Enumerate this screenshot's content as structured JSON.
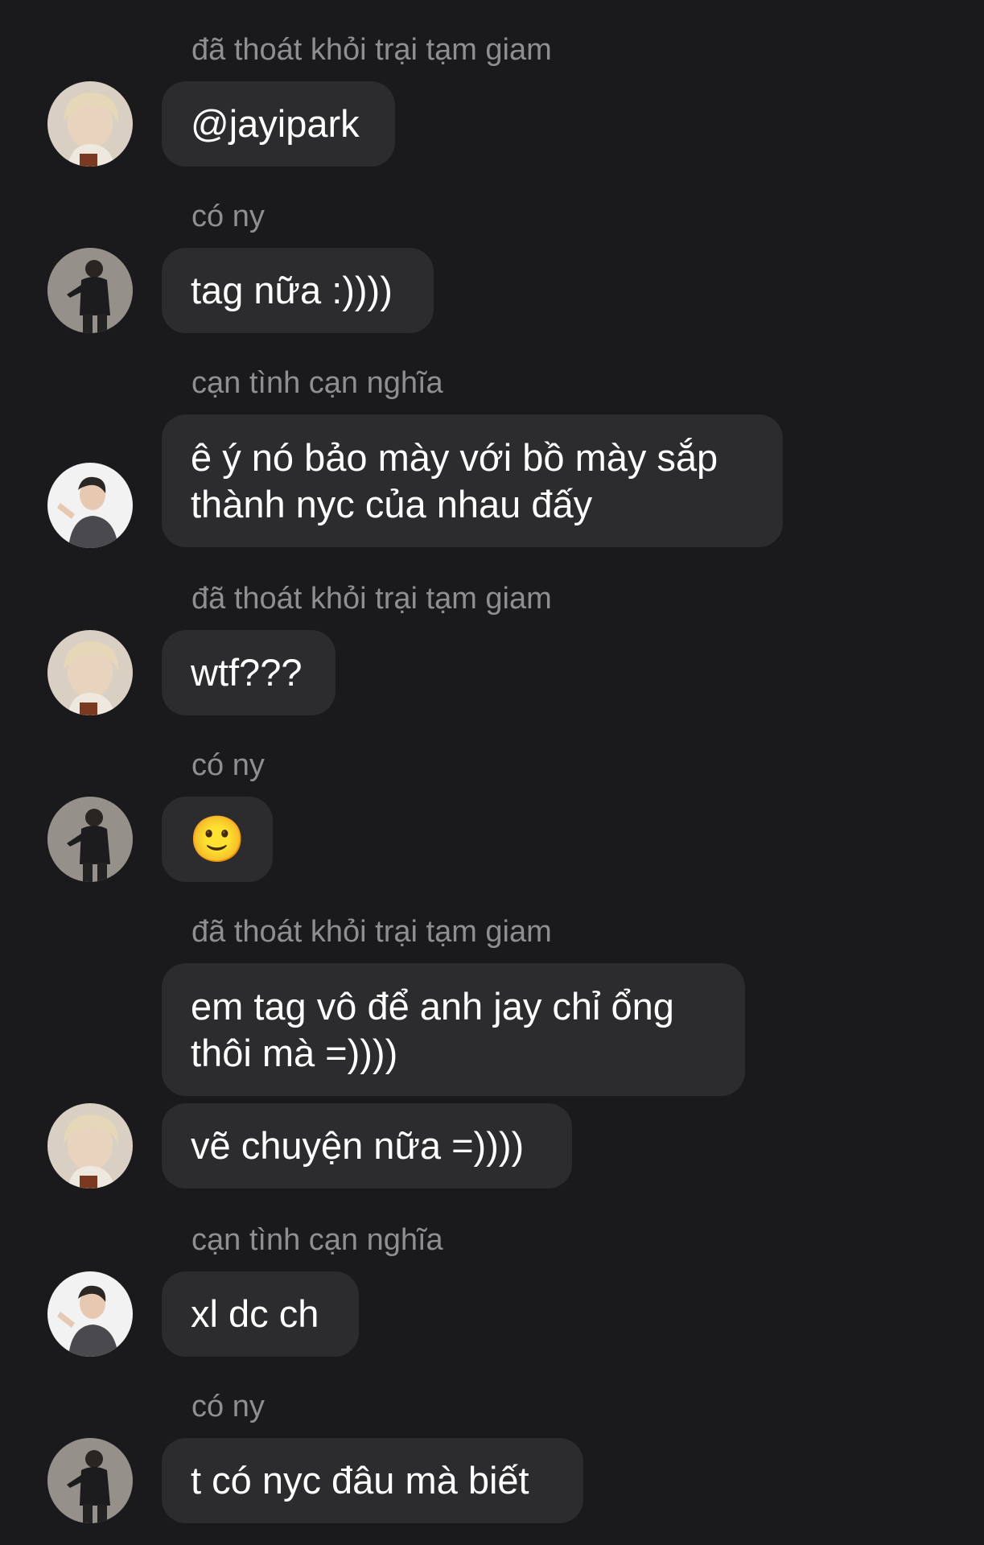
{
  "messages": [
    {
      "sender": "đã thoát khỏi trại tạm giam",
      "bubbles": [
        "@jayipark"
      ],
      "avatar": "avatar-blond"
    },
    {
      "sender": "có ny",
      "bubbles": [
        "tag nữa :))))"
      ],
      "avatar": "avatar-dark-suit"
    },
    {
      "sender": "cạn tình cạn nghĩa",
      "bubbles": [
        "ê ý nó bảo mày với bồ mày sắp\nthành nyc của nhau đấy"
      ],
      "avatar": "avatar-white-bg"
    },
    {
      "sender": "đã thoát khỏi trại tạm giam",
      "bubbles": [
        "wtf???"
      ],
      "avatar": "avatar-blond"
    },
    {
      "sender": "có ny",
      "bubbles": [
        "🙂"
      ],
      "avatar": "avatar-dark-suit"
    },
    {
      "sender": "đã thoát khỏi trại tạm giam",
      "bubbles": [
        "em tag vô để anh jay chỉ ổng\nthôi mà =))))",
        "vẽ chuyện nữa =))))"
      ],
      "avatar": "avatar-blond"
    },
    {
      "sender": "cạn tình cạn nghĩa",
      "bubbles": [
        "xl dc ch"
      ],
      "avatar": "avatar-white-bg"
    },
    {
      "sender": "có ny",
      "bubbles": [
        "t có nyc đâu mà biết"
      ],
      "avatar": "avatar-dark-suit"
    }
  ],
  "colors": {
    "background": "#1a1a1c",
    "bubble": "#2c2c2e",
    "sender_text": "#8e8e93",
    "message_text": "#ffffff"
  }
}
